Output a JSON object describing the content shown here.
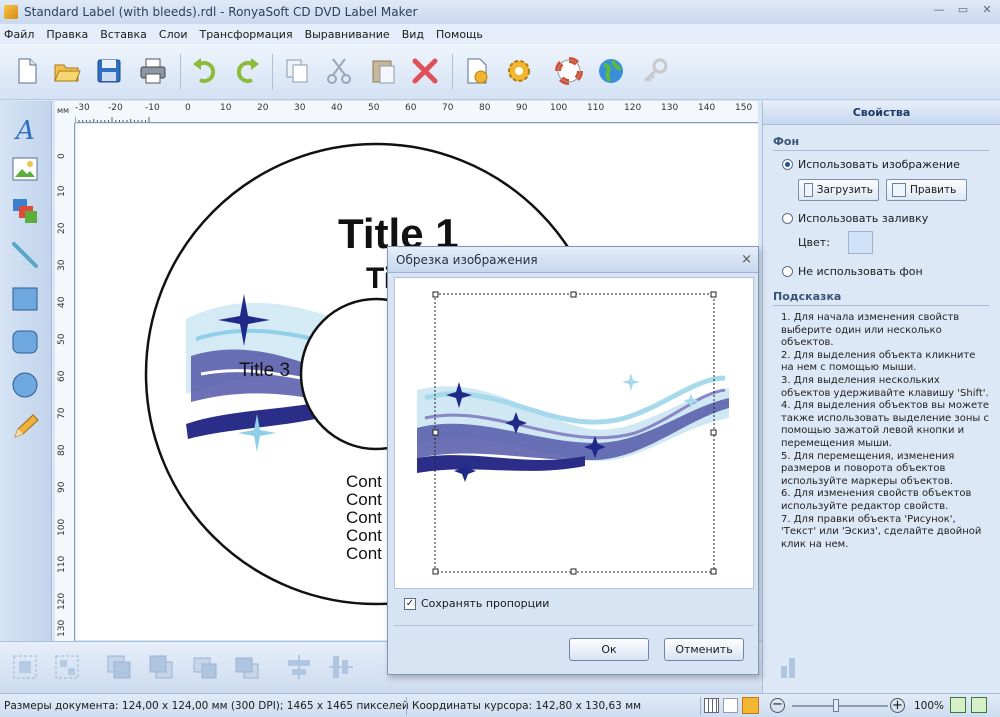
{
  "window": {
    "title": "Standard Label (with bleeds).rdl - RonyaSoft CD DVD Label Maker"
  },
  "menu": [
    "Файл",
    "Правка",
    "Вставка",
    "Слои",
    "Трансформация",
    "Выравнивание",
    "Вид",
    "Помощь"
  ],
  "ruler": {
    "unit": "мм",
    "top_ticks": [
      "-30",
      "-20",
      "-10",
      "0",
      "10",
      "20",
      "30",
      "40",
      "50",
      "60",
      "70",
      "80",
      "90",
      "100",
      "110",
      "120",
      "130",
      "140",
      "150"
    ],
    "left_ticks": [
      "0",
      "10",
      "20",
      "30",
      "40",
      "50",
      "60",
      "70",
      "80",
      "90",
      "100",
      "110",
      "120",
      "130"
    ]
  },
  "canvas": {
    "title1": "Title 1",
    "title2": "Ti",
    "title3": "Title 3",
    "contents": [
      "Cont",
      "Cont",
      "Cont",
      "Cont",
      "Cont"
    ]
  },
  "panel": {
    "header": "Свойства",
    "background_section": "Фон",
    "use_image": "Использовать изображение",
    "load_button": "Загрузить",
    "edit_button": "Править",
    "use_fill": "Использовать заливку",
    "color_label": "Цвет:",
    "fill_color": "#cfe2f7",
    "no_background": "Не использовать фон",
    "hint_section": "Подсказка",
    "hint_text": "1. Для начала изменения свойств выберите один или несколько объектов.\n2. Для выделения объекта кликните на нем с помощью мыши.\n3. Для выделения нескольких объектов удерживайте клавишу 'Shift'.\n4. Для выделения объектов вы можете также использовать выделение зоны с помощью зажатой левой кнопки и перемещения мыши.\n5. Для перемещения, изменения размеров и поворота объектов используйте маркеры объектов.\n6. Для изменения свойств объектов используйте редактор свойств.\n7. Для правки объекта 'Рисунок', 'Текст' или 'Эскиз', сделайте двойной клик на нем."
  },
  "dialog": {
    "title": "Обрезка изображения",
    "close": "×",
    "keep_proportions": "Сохранять пропорции",
    "ok": "Ок",
    "cancel": "Отменить"
  },
  "status": {
    "doc_size": "Размеры документа: 124,00 x 124,00 мм (300 DPI); 1465 x 1465 пикселей",
    "cursor": "Координаты курсора: 142,80 x 130,63 мм",
    "zoom": "100%"
  }
}
